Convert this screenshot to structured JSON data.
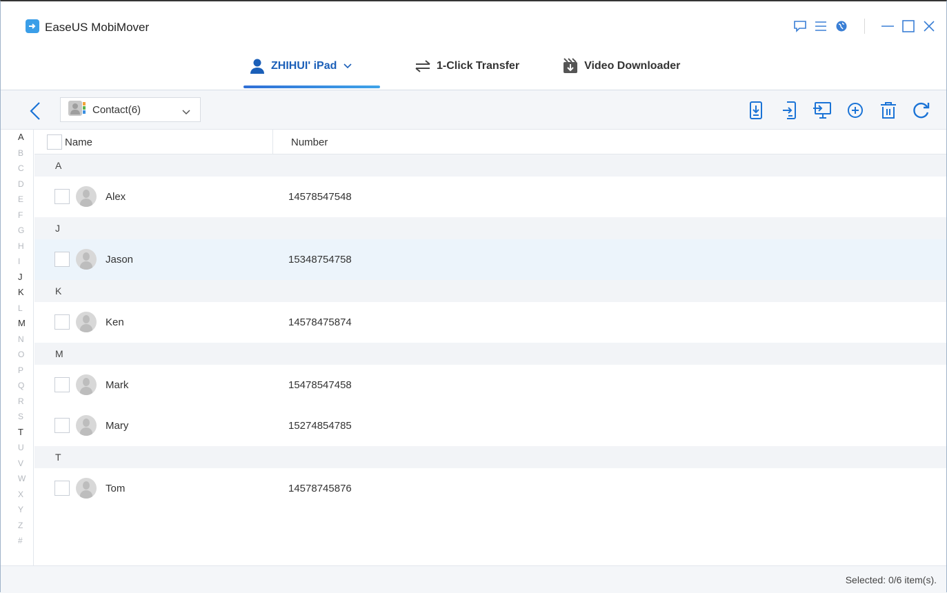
{
  "app": {
    "title": "EaseUS MobiMover"
  },
  "tabs": [
    {
      "label": "ZHIHUI' iPad",
      "icon": "user-icon",
      "active": true
    },
    {
      "label": "1-Click Transfer",
      "icon": "transfer-arrows-icon",
      "active": false
    },
    {
      "label": "Video Downloader",
      "icon": "video-download-icon",
      "active": false
    }
  ],
  "toolbar": {
    "selector_label": "Contact(6)",
    "tools": [
      "export-to-device-icon",
      "import-icon",
      "export-to-computer-icon",
      "add-icon",
      "delete-icon",
      "refresh-icon"
    ]
  },
  "alpha_index": {
    "letters": [
      "A",
      "B",
      "C",
      "D",
      "E",
      "F",
      "G",
      "H",
      "I",
      "J",
      "K",
      "L",
      "M",
      "N",
      "O",
      "P",
      "Q",
      "R",
      "S",
      "T",
      "U",
      "V",
      "W",
      "X",
      "Y",
      "Z",
      "#"
    ],
    "active": [
      "A",
      "J",
      "K",
      "M",
      "T"
    ]
  },
  "table": {
    "columns": {
      "name": "Name",
      "number": "Number"
    },
    "groups": [
      {
        "letter": "A",
        "rows": [
          {
            "name": "Alex",
            "number": "14578547548"
          }
        ]
      },
      {
        "letter": "J",
        "rows": [
          {
            "name": "Jason",
            "number": "15348754758"
          }
        ]
      },
      {
        "letter": "K",
        "rows": [
          {
            "name": "Ken",
            "number": "14578475874"
          }
        ]
      },
      {
        "letter": "M",
        "rows": [
          {
            "name": "Mark",
            "number": "15478547458"
          },
          {
            "name": "Mary",
            "number": "15274854785"
          }
        ]
      },
      {
        "letter": "T",
        "rows": [
          {
            "name": "Tom",
            "number": "14578745876"
          }
        ]
      }
    ]
  },
  "status": {
    "text": "Selected: 0/6 item(s)."
  },
  "colors": {
    "accent": "#1b5fb8",
    "icon_blue": "#1a73d6"
  }
}
